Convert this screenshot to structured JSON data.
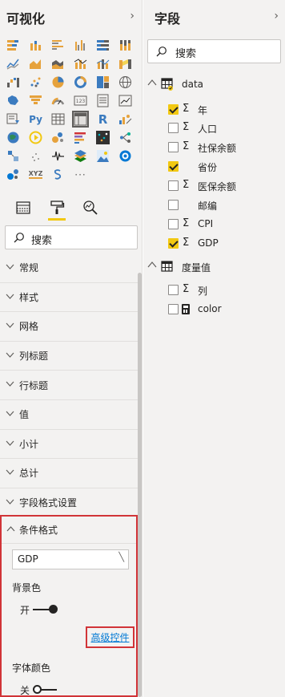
{
  "viz_pane": {
    "title": "可视化",
    "search_placeholder": "搜索",
    "more_label": "···",
    "python_label": "Py",
    "r_label": "R",
    "xyz_label": "XYZ",
    "sections": [
      "常规",
      "样式",
      "网格",
      "列标题",
      "行标题",
      "值",
      "小计",
      "总计",
      "字段格式设置"
    ],
    "conditional_format": {
      "header": "条件格式",
      "selected_field": "GDP",
      "background_label": "背景色",
      "background_toggle": "开",
      "advanced_link": "高级控件",
      "font_color_label": "字体颜色",
      "font_toggle": "关"
    }
  },
  "fields_pane": {
    "title": "字段",
    "search_placeholder": "搜索",
    "tables": [
      {
        "name": "data",
        "fields": [
          {
            "name": "年",
            "checked": true,
            "sigma": true
          },
          {
            "name": "人口",
            "checked": false,
            "sigma": true
          },
          {
            "name": "社保余额",
            "checked": false,
            "sigma": true
          },
          {
            "name": "省份",
            "checked": true,
            "sigma": false
          },
          {
            "name": "医保余额",
            "checked": false,
            "sigma": true
          },
          {
            "name": "邮编",
            "checked": false,
            "sigma": false
          },
          {
            "name": "CPI",
            "checked": false,
            "sigma": true
          },
          {
            "name": "GDP",
            "checked": true,
            "sigma": true
          }
        ]
      },
      {
        "name": "度量值",
        "fields": [
          {
            "name": "列",
            "checked": false,
            "sigma": true
          },
          {
            "name": "color",
            "checked": false,
            "calc": true
          }
        ]
      }
    ]
  },
  "colors": {
    "accent": "#f2c811",
    "highlight_border": "#d13438",
    "link": "#0078d4"
  }
}
